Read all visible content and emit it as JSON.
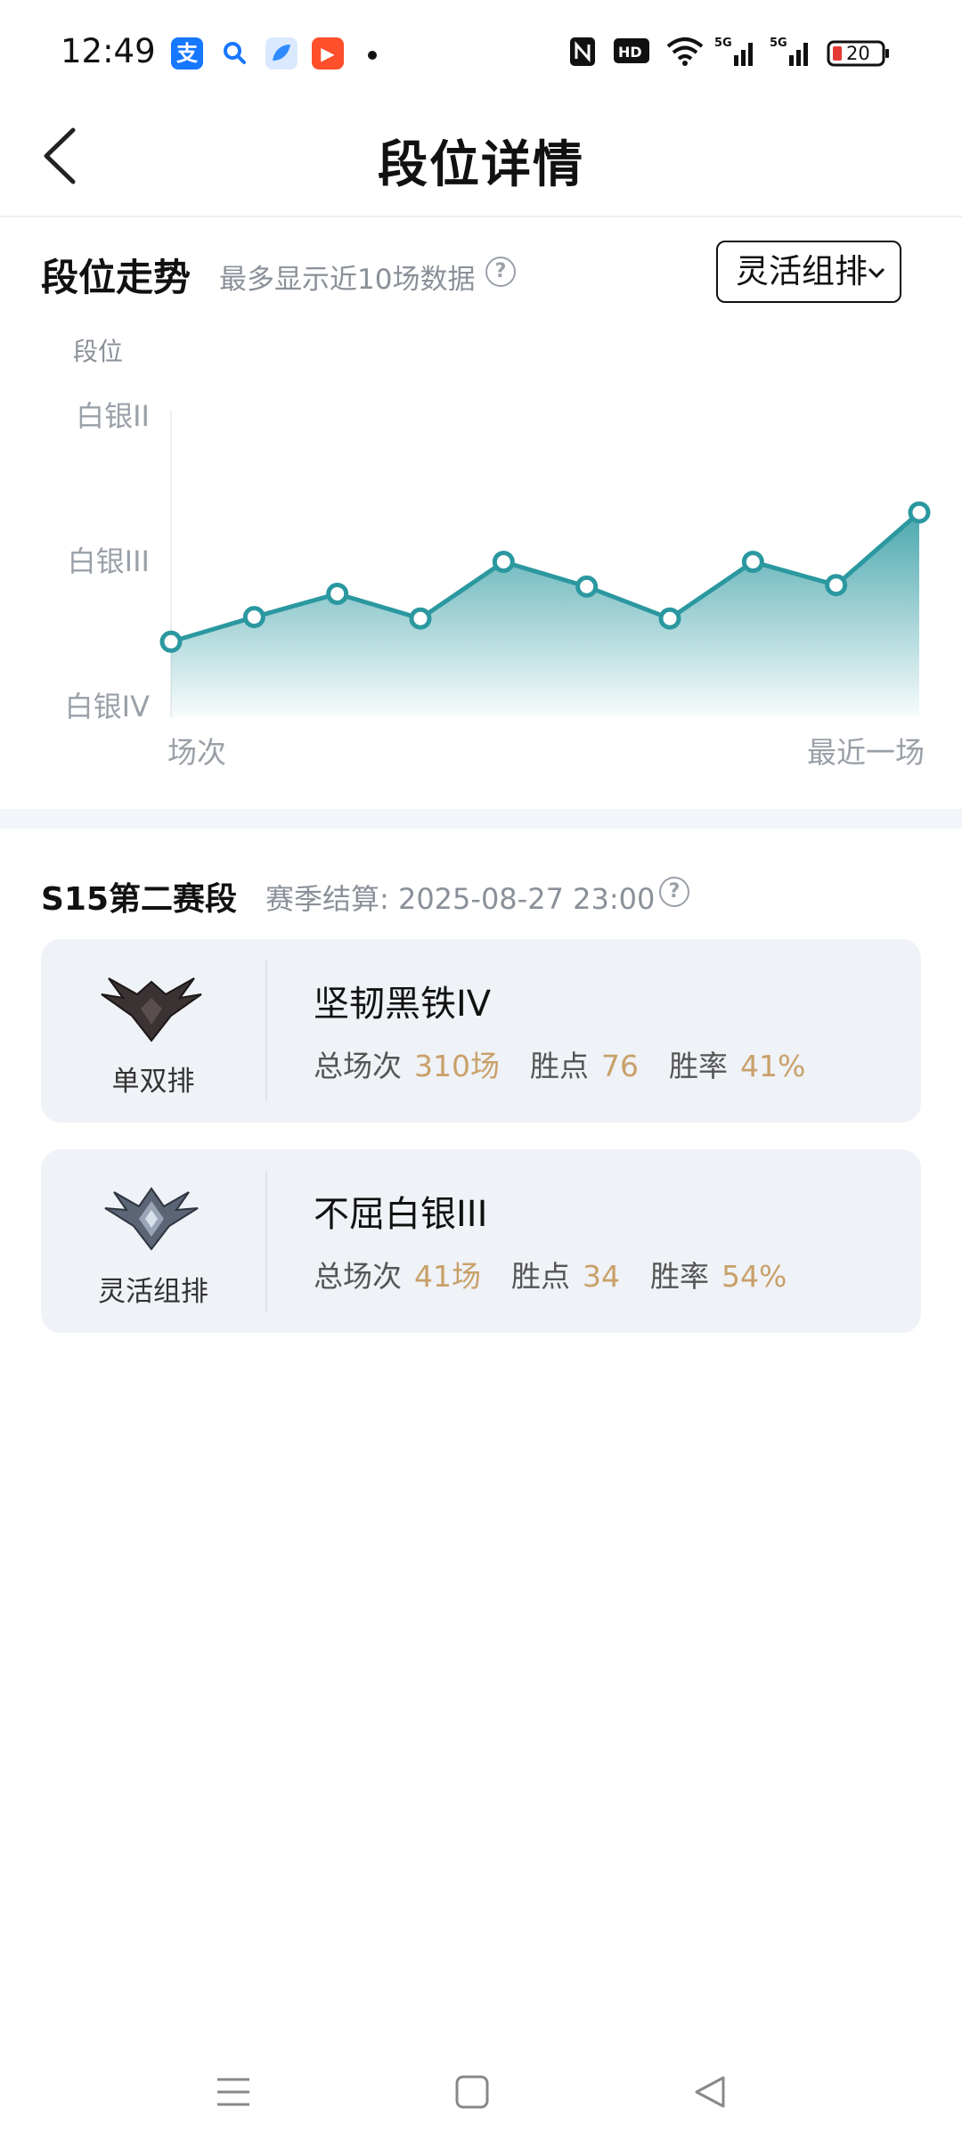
{
  "status_bar": {
    "time": "12:49",
    "apps": [
      {
        "name": "alipay-icon",
        "glyph": "支",
        "color": "#1677ff"
      },
      {
        "name": "search-app-icon",
        "glyph": "🔍",
        "color": "#ffffff"
      },
      {
        "name": "browser-icon",
        "glyph": "",
        "color": "#2f8cff"
      },
      {
        "name": "video-app-icon",
        "glyph": "▶",
        "color": "#ff4f2b"
      }
    ],
    "battery": "20"
  },
  "header": {
    "title": "段位详情"
  },
  "trend": {
    "title": "段位走势",
    "subtitle": "最多显示近10场数据",
    "dropdown_value": "灵活组排",
    "accent_color": "#2b98a0"
  },
  "chart_data": {
    "type": "area",
    "ylabel": "段位",
    "y_ticks": [
      "白银II",
      "白银III",
      "白银IV"
    ],
    "x_labels": [
      "场次",
      "最近一场"
    ],
    "x": [
      1,
      2,
      3,
      4,
      5,
      6,
      7,
      8,
      9,
      10
    ],
    "values": [
      3.44,
      3.61,
      3.77,
      3.6,
      3.99,
      3.82,
      3.6,
      3.99,
      3.83,
      4.33
    ],
    "value_scale_note_ticks": {
      "白银IV": 3,
      "白银III": 4,
      "白银II": 5
    },
    "ylim": [
      3,
      5
    ],
    "grid": false
  },
  "season": {
    "title": "S15第二赛段",
    "settle_label": "赛季结算: 2025-08-27 23:00",
    "cards": [
      {
        "queue": "单双排",
        "rank": "坚韧黑铁IV",
        "games_label": "总场次",
        "games": "310场",
        "lp_label": "胜点",
        "lp": "76",
        "wr_label": "胜率",
        "wr": "41%"
      },
      {
        "queue": "灵活组排",
        "rank": "不屈白银III",
        "games_label": "总场次",
        "games": "41场",
        "lp_label": "胜点",
        "lp": "34",
        "wr_label": "胜率",
        "wr": "54%"
      }
    ]
  }
}
